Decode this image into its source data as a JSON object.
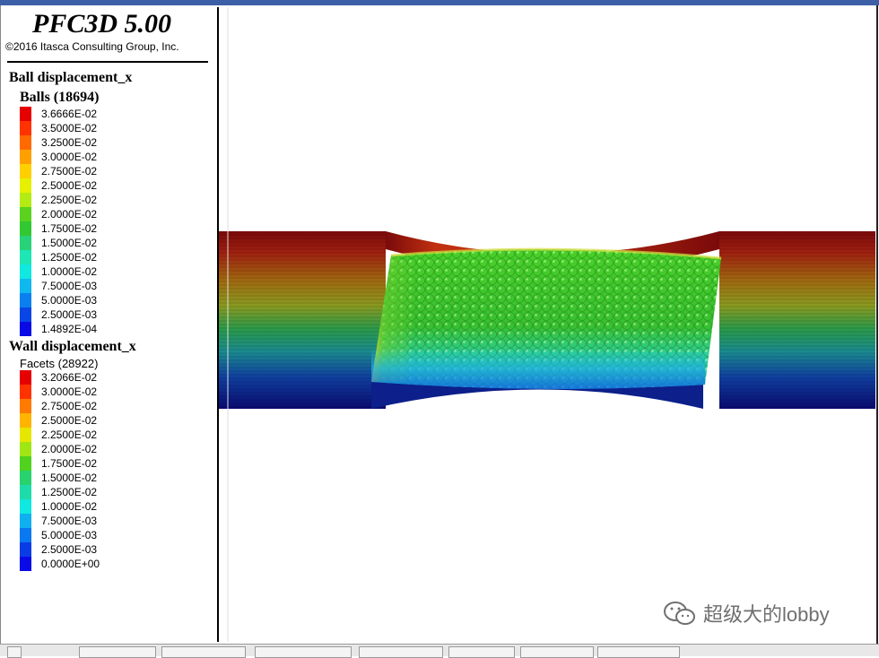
{
  "app": {
    "title": "PFC3D 5.00",
    "copyright": "©2016 Itasca Consulting Group, Inc."
  },
  "ball_legend": {
    "title": "Ball displacement_x",
    "subtitle": "Balls (18694)",
    "entries": [
      {
        "label": "3.6666E-02",
        "color": "#e60000"
      },
      {
        "label": "3.5000E-02",
        "color": "#ff3300"
      },
      {
        "label": "3.2500E-02",
        "color": "#ff6a00"
      },
      {
        "label": "3.0000E-02",
        "color": "#ffa000"
      },
      {
        "label": "2.7500E-02",
        "color": "#ffd000"
      },
      {
        "label": "2.5000E-02",
        "color": "#e6f000"
      },
      {
        "label": "2.2500E-02",
        "color": "#b4eb14"
      },
      {
        "label": "2.0000E-02",
        "color": "#5ad21e"
      },
      {
        "label": "1.7500E-02",
        "color": "#32c832"
      },
      {
        "label": "1.5000E-02",
        "color": "#28d278"
      },
      {
        "label": "1.2500E-02",
        "color": "#1ee6b4"
      },
      {
        "label": "1.0000E-02",
        "color": "#10e8e0"
      },
      {
        "label": "7.5000E-03",
        "color": "#10b8f0"
      },
      {
        "label": "5.0000E-03",
        "color": "#0a80f0"
      },
      {
        "label": "2.5000E-03",
        "color": "#0a46e6"
      },
      {
        "label": "1.4892E-04",
        "color": "#0a0ae6"
      }
    ]
  },
  "wall_legend": {
    "title": "Wall displacement_x",
    "subtitle": "Facets (28922)",
    "entries": [
      {
        "label": "3.2066E-02",
        "color": "#e60000"
      },
      {
        "label": "3.0000E-02",
        "color": "#ff3300"
      },
      {
        "label": "2.7500E-02",
        "color": "#ff7a00"
      },
      {
        "label": "2.5000E-02",
        "color": "#ffb400"
      },
      {
        "label": "2.2500E-02",
        "color": "#e6e600"
      },
      {
        "label": "2.0000E-02",
        "color": "#a0e614"
      },
      {
        "label": "1.7500E-02",
        "color": "#50d21e"
      },
      {
        "label": "1.5000E-02",
        "color": "#28d26e"
      },
      {
        "label": "1.2500E-02",
        "color": "#1edcaa"
      },
      {
        "label": "1.0000E-02",
        "color": "#10e8e0"
      },
      {
        "label": "7.5000E-03",
        "color": "#10b0f0"
      },
      {
        "label": "5.0000E-03",
        "color": "#0a78f0"
      },
      {
        "label": "2.5000E-03",
        "color": "#0a3ce6"
      },
      {
        "label": "0.0000E+00",
        "color": "#0a0ae6"
      }
    ]
  },
  "watermark": {
    "text": "超级大的lobby",
    "icon": "wechat-icon"
  },
  "colors": {
    "frame_top": "#3c5fa8",
    "watermark": "#6f6f6f"
  }
}
